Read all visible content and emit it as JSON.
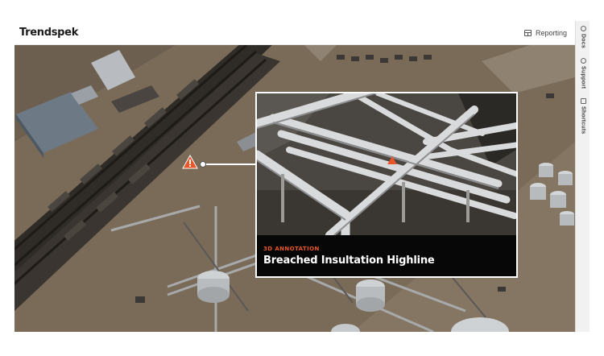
{
  "app": {
    "logo_text": "Trendspek"
  },
  "topbar": {
    "reporting_label": "Reporting",
    "reporting_icon": "calendar-grid-icon"
  },
  "sidebar": {
    "items": [
      {
        "label": "Docs",
        "icon": "circle-icon"
      },
      {
        "label": "Support",
        "icon": "circle-icon"
      },
      {
        "label": "Shortcuts",
        "icon": "square-icon"
      }
    ]
  },
  "annotation": {
    "type_label": "3D ANNOTATION",
    "title": "Breached Insultation Highline",
    "marker_icon": "warning-triangle-icon",
    "accent_color": "#e8562a"
  }
}
